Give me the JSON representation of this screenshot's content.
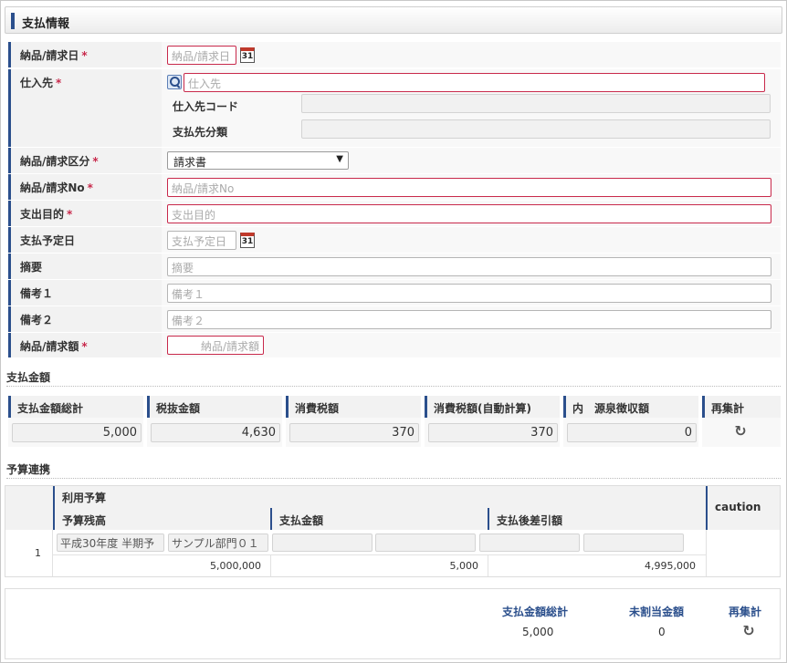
{
  "section": {
    "title": "支払情報"
  },
  "form": {
    "invoice_date": {
      "label": "納品/請求日",
      "placeholder": "納品/請求日"
    },
    "supplier": {
      "label": "仕入先",
      "placeholder": "仕入先",
      "code_label": "仕入先コード",
      "class_label": "支払先分類"
    },
    "invoice_type": {
      "label": "納品/請求区分",
      "selected": "請求書"
    },
    "invoice_no": {
      "label": "納品/請求No",
      "placeholder": "納品/請求No"
    },
    "purpose": {
      "label": "支出目的",
      "placeholder": "支出目的"
    },
    "payment_date": {
      "label": "支払予定日",
      "placeholder": "支払予定日"
    },
    "summary": {
      "label": "摘要",
      "placeholder": "摘要"
    },
    "note1": {
      "label": "備考１",
      "placeholder": "備考１"
    },
    "note2": {
      "label": "備考２",
      "placeholder": "備考２"
    },
    "invoice_amount": {
      "label": "納品/請求額",
      "placeholder": "納品/請求額"
    },
    "required_mark": "*"
  },
  "amount": {
    "caption": "支払金額",
    "headers": [
      "支払金額総計",
      "税抜金額",
      "消費税額",
      "消費税額(自動計算)",
      "内　源泉徴収額",
      "再集計"
    ],
    "values": [
      "5,000",
      "4,630",
      "370",
      "370",
      "0"
    ],
    "refresh_icon": "refresh-icon"
  },
  "budget": {
    "caption": "予算連携",
    "use_budget": "利用予算",
    "headers": [
      "予算残高",
      "支払金額",
      "支払後差引額"
    ],
    "caution": "caution",
    "row_no": "1",
    "fiscal": "平成30年度 半期予",
    "department": "サンプル部門０１",
    "remain": "5,000,000",
    "paid": "5,000",
    "after": "4,995,000"
  },
  "totals": {
    "total_label": "支払金額総計",
    "total_value": "5,000",
    "unassigned_label": "未割当金額",
    "unassigned_value": "0",
    "recalc_label": "再集計"
  }
}
